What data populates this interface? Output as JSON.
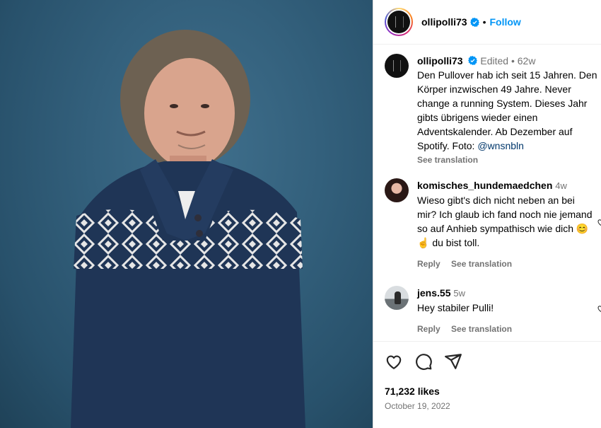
{
  "post": {
    "username": "ollipolli73",
    "follow_label": "Follow",
    "separator": "•"
  },
  "caption": {
    "username": "ollipolli73",
    "edited_label": "Edited",
    "dot": "•",
    "age": "62w",
    "text": "Den Pullover hab ich seit 15 Jahren. Den Körper inzwischen 49 Jahre. Never change a running System. Dieses Jahr gibts übrigens wieder einen Adventskalender. Ab Dezember auf Spotify. Foto: ",
    "mention": "@wnsnbln",
    "see_translation": "See translation"
  },
  "comments": [
    {
      "username": "komisches_hundemaedchen",
      "age": "4w",
      "text": "Wieso gibt's dich nicht neben an bei mir? Ich glaub ich fand noch nie jemand so auf Anhieb sympathisch wie dich 😊☝ du bist toll.",
      "reply": "Reply",
      "see_translation": "See translation"
    },
    {
      "username": "jens.55",
      "age": "5w",
      "text": "Hey stabiler Pulli!",
      "reply": "Reply",
      "see_translation": "See translation"
    }
  ],
  "footer": {
    "likes": "71,232 likes",
    "date": "October 19, 2022"
  },
  "colors": {
    "accent": "#0095f6",
    "verified": "#0095f6",
    "muted": "#737373"
  }
}
